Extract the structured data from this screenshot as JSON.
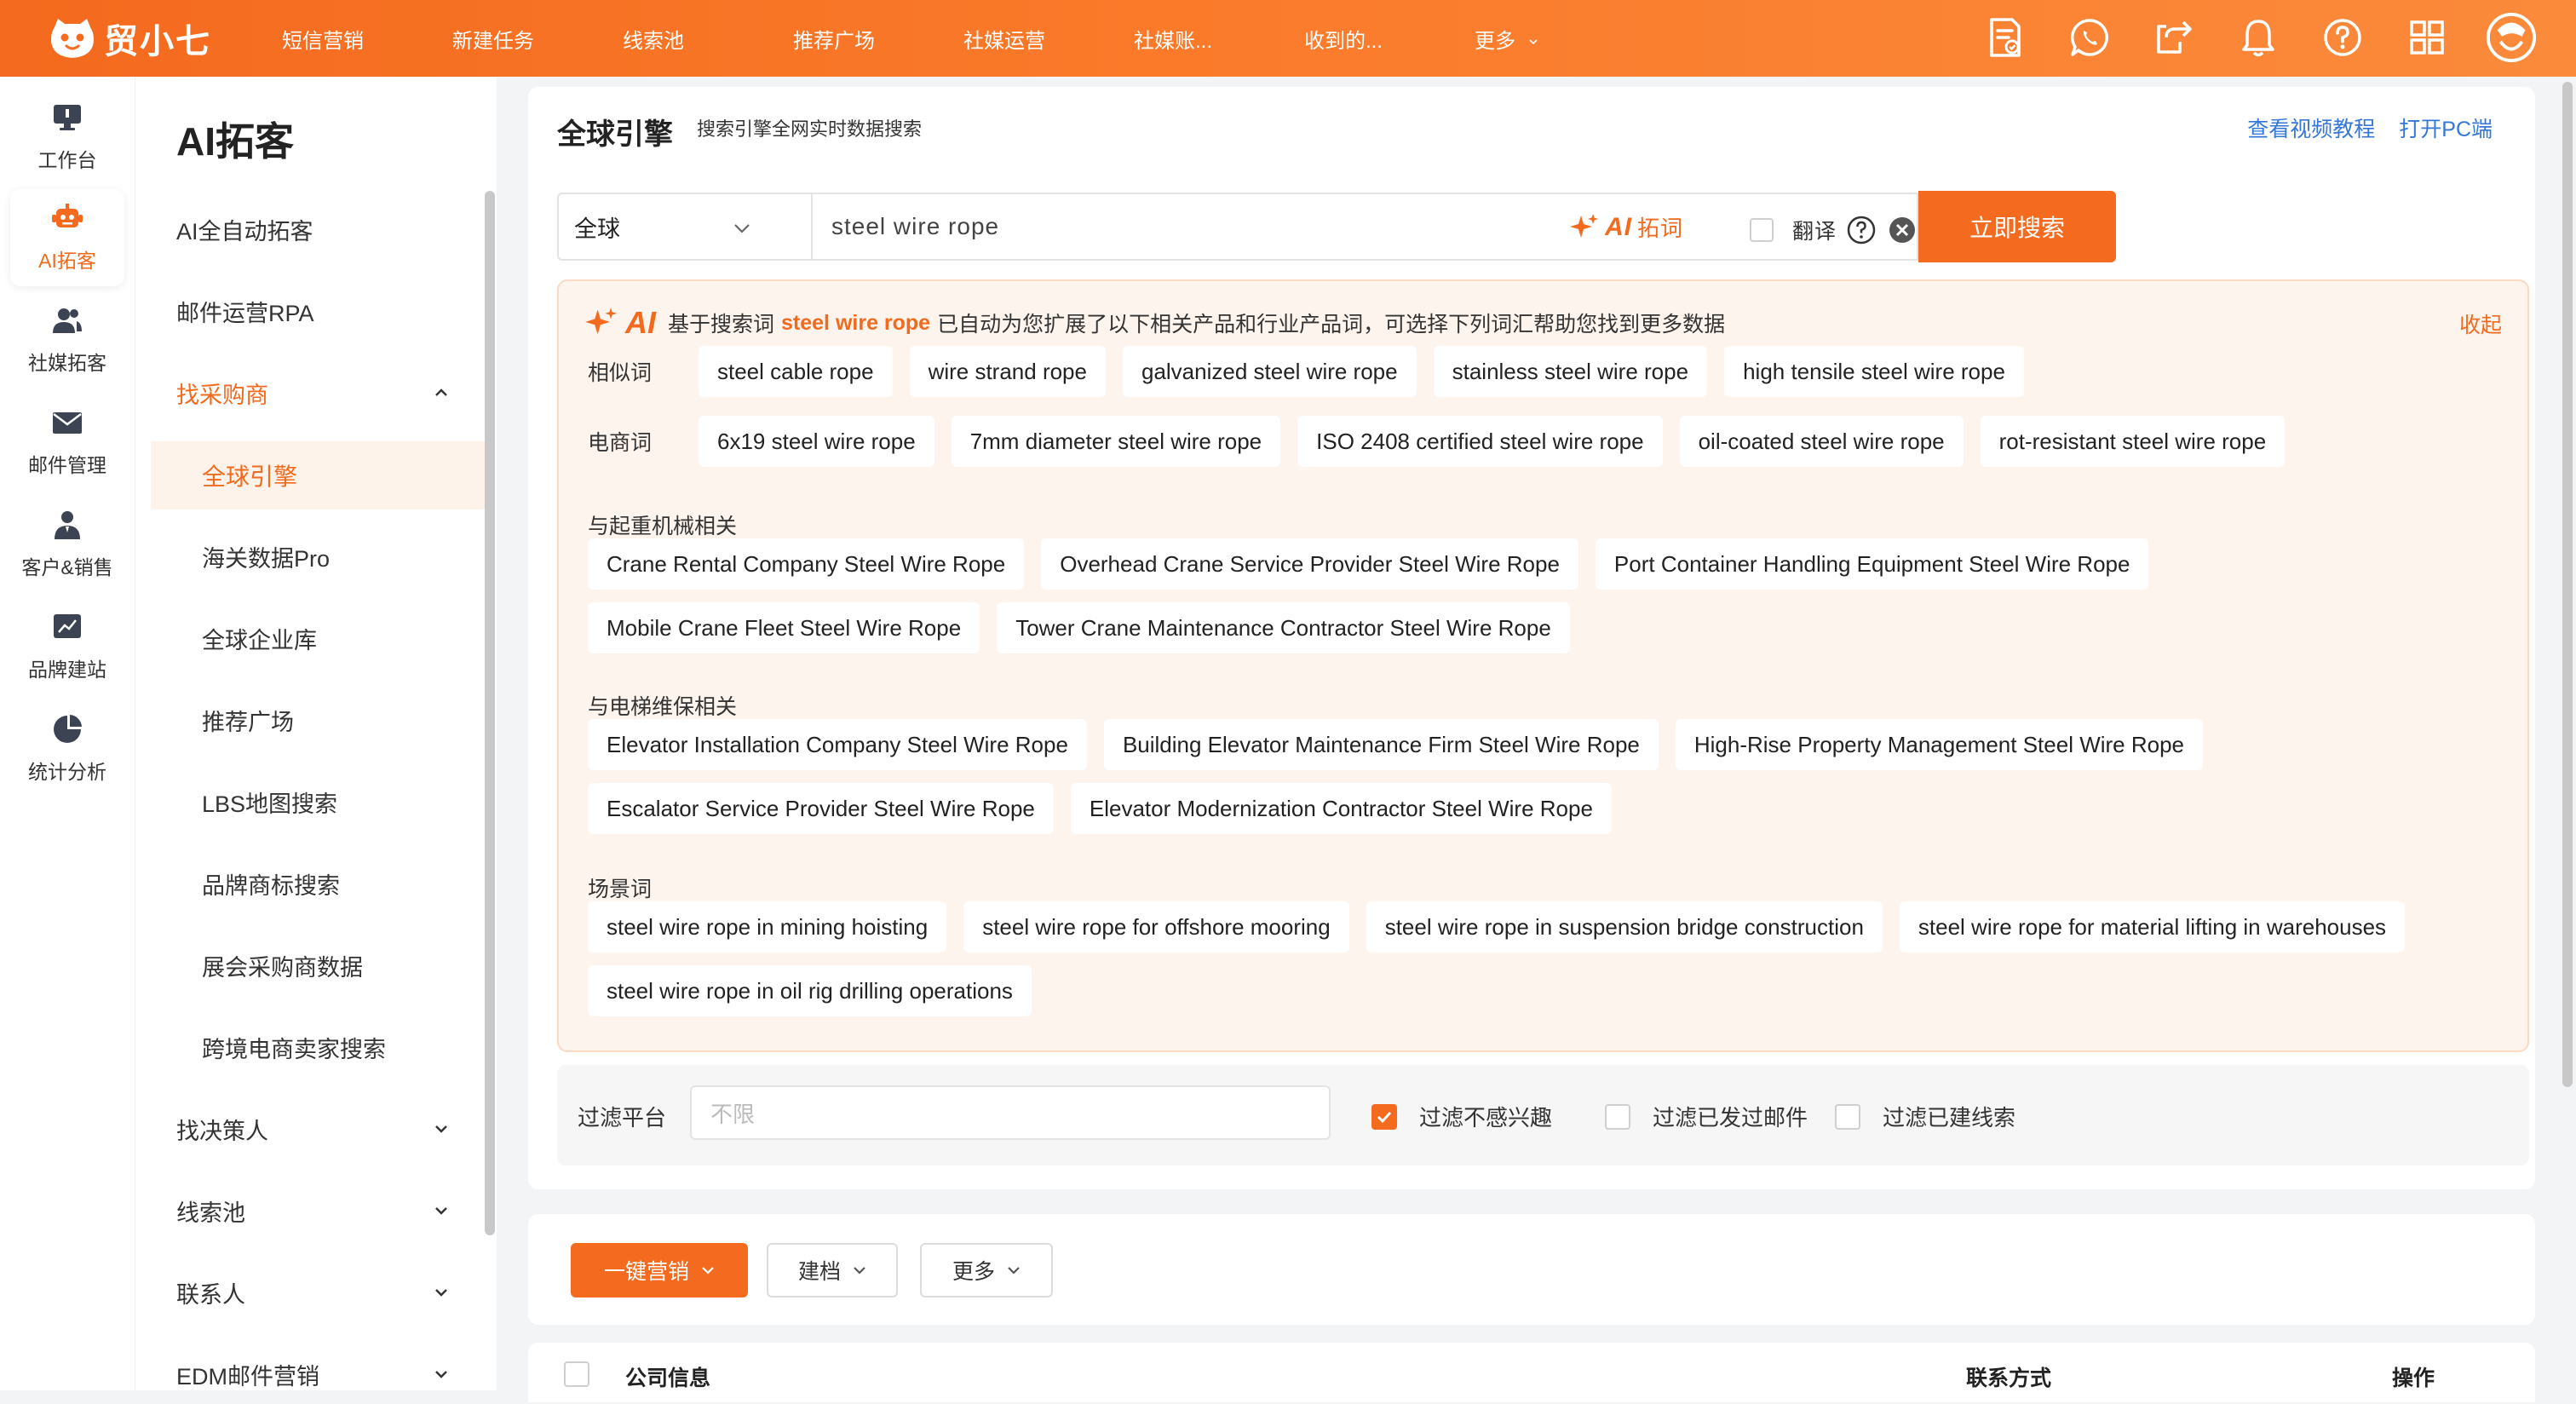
{
  "brand": {
    "name": "贸小七"
  },
  "topnav": {
    "items": [
      "短信营销",
      "新建任务",
      "线索池",
      "推荐广场",
      "社媒运营",
      "社媒账...",
      "收到的..."
    ],
    "more_label": "更多"
  },
  "rail": {
    "items": [
      {
        "label": "工作台",
        "icon": "monitor-icon"
      },
      {
        "label": "AI拓客",
        "icon": "robot-icon"
      },
      {
        "label": "社媒拓客",
        "icon": "users-icon"
      },
      {
        "label": "邮件管理",
        "icon": "mail-icon"
      },
      {
        "label": "客户&销售",
        "icon": "person-icon"
      },
      {
        "label": "品牌建站",
        "icon": "chart-icon"
      },
      {
        "label": "统计分析",
        "icon": "pie-icon"
      }
    ]
  },
  "subnav": {
    "title": "AI拓客",
    "items": {
      "auto": "AI全自动拓客",
      "rpa": "邮件运营RPA",
      "find_buyer": "找采购商",
      "global_engine": "全球引擎",
      "customs": "海关数据Pro",
      "company_db": "全球企业库",
      "square": "推荐广场",
      "lbs": "LBS地图搜索",
      "trademark": "品牌商标搜索",
      "expo": "展会采购商数据",
      "ecom": "跨境电商卖家搜索",
      "decision": "找决策人",
      "leads": "线索池",
      "contacts": "联系人",
      "edm": "EDM邮件营销"
    }
  },
  "page": {
    "title": "全球引擎",
    "subtitle": "搜索引擎全网实时数据搜索",
    "link_video": "查看视频教程",
    "link_pc": "打开PC端"
  },
  "search": {
    "region": "全球",
    "query": "steel wire rope",
    "ai_label": "AI",
    "ai_suffix": "拓词",
    "translate_label": "翻译",
    "button": "立即搜索"
  },
  "ai_box": {
    "badge": "AI",
    "prefix": "基于搜索词",
    "keyword": "steel wire rope",
    "suffix": "已自动为您扩展了以下相关产品和行业产品词，可选择下列词汇帮助您找到更多数据",
    "collapse": "收起",
    "similar_label": "相似词",
    "similar": [
      "steel cable rope",
      "wire strand rope",
      "galvanized steel wire rope",
      "stainless steel wire rope",
      "high tensile steel wire rope"
    ],
    "ecom_label": "电商词",
    "ecom": [
      "6x19 steel wire rope",
      "7mm diameter steel wire rope",
      "ISO 2408 certified steel wire rope",
      "oil-coated steel wire rope",
      "rot-resistant steel wire rope"
    ],
    "crane_label": "与起重机械相关",
    "crane_row1": [
      "Crane Rental Company Steel Wire Rope",
      "Overhead Crane Service Provider Steel Wire Rope",
      "Port Container Handling Equipment Steel Wire Rope"
    ],
    "crane_row2": [
      "Mobile Crane Fleet Steel Wire Rope",
      "Tower Crane Maintenance Contractor Steel Wire Rope"
    ],
    "elevator_label": "与电梯维保相关",
    "elevator_row1": [
      "Elevator Installation Company Steel Wire Rope",
      "Building Elevator Maintenance Firm Steel Wire Rope",
      "High-Rise Property Management Steel Wire Rope"
    ],
    "elevator_row2": [
      "Escalator Service Provider Steel Wire Rope",
      "Elevator Modernization Contractor Steel Wire Rope"
    ],
    "scene_label": "场景词",
    "scene_row1": [
      "steel wire rope in mining hoisting",
      "steel wire rope for offshore mooring",
      "steel wire rope in suspension bridge construction",
      "steel wire rope for material lifting in warehouses"
    ],
    "scene_row2": [
      "steel wire rope in oil rig drilling operations"
    ]
  },
  "filter": {
    "label": "过滤平台",
    "placeholder": "不限",
    "opt_uninterested": "过滤不感兴趣",
    "opt_uninterested_checked": true,
    "opt_emailed": "过滤已发过邮件",
    "opt_emailed_checked": false,
    "opt_leads": "过滤已建线索",
    "opt_leads_checked": false
  },
  "actions": {
    "marketing": "一键营销",
    "archive": "建档",
    "more": "更多"
  },
  "table": {
    "columns": [
      "公司信息",
      "联系方式",
      "操作"
    ]
  },
  "colors": {
    "accent": "#f46a1e",
    "link": "#3477d8",
    "ai_bg": "#fdf4ee"
  }
}
